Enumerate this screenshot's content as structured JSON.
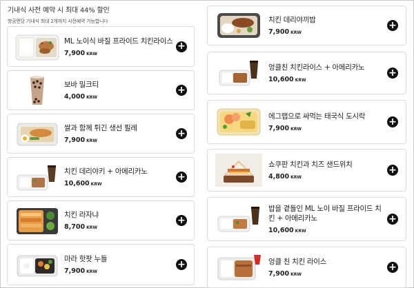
{
  "header": {
    "title": "기내식 사전 예약 시 최대 44% 할인",
    "subtitle": "항공편당 기내식 최대 2개까지 사전예약 가능합니다"
  },
  "currency_label": "KRW",
  "add_icon": "plus-circle-icon",
  "left_items": [
    {
      "name": "ML 노이식 바질 프라이드 치킨라이스",
      "price": "7,900",
      "thumb": "chicken-rice-tray"
    },
    {
      "name": "보바 밀크티",
      "price": "4,000",
      "thumb": "boba-milk-tea"
    },
    {
      "name": "쌀과 함께 튀긴 생선 필레",
      "price": "7,900",
      "thumb": "fish-fillet-tray"
    },
    {
      "name": "치킨 데리야키 + 아메리카노",
      "price": "10,600",
      "thumb": "teriyaki-coffee"
    },
    {
      "name": "치킨 라자냐",
      "price": "8,700",
      "thumb": "lasagna-tray"
    },
    {
      "name": "마라 핫팟 누들",
      "price": "7,900",
      "thumb": "mala-noodle-tray"
    }
  ],
  "right_items": [
    {
      "name": "치킨 데리야끼밥",
      "price": "7,900",
      "thumb": "teriyaki-rice-tray"
    },
    {
      "name": "엉클친 치킨라이스 + 아메리카노",
      "price": "10,600",
      "thumb": "chicken-rice-coffee"
    },
    {
      "name": "에그랩으로 싸먹는 태국식 도시락",
      "price": "7,900",
      "thumb": "thai-lunchbox"
    },
    {
      "name": "쇼쿠판 치킨과 치즈 샌드위치",
      "price": "4,800",
      "thumb": "shokupan-sandwich"
    },
    {
      "name": "밥을 곁들인 ML 노이 바질 프라이드 치킨 + 아메리카노",
      "price": "10,600",
      "thumb": "basil-chicken-coffee"
    },
    {
      "name": "엉클 친 치킨 라이스",
      "price": "7,900",
      "thumb": "uncle-chin-rice"
    }
  ]
}
